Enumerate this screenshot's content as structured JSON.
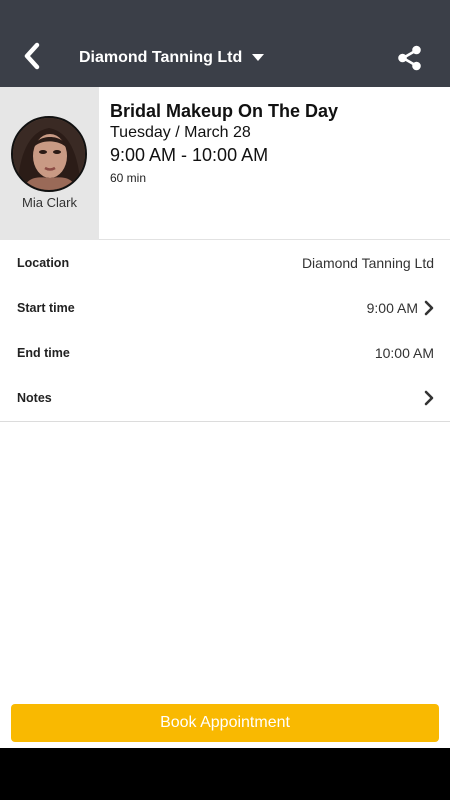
{
  "header": {
    "title": "Diamond Tanning Ltd",
    "back_icon": "chevron-left-icon",
    "dropdown_icon": "caret-down-icon",
    "share_icon": "share-icon",
    "background": "#3b3f48"
  },
  "staff": {
    "name": "Mia Clark"
  },
  "appointment": {
    "title": "Bridal Makeup On The Day",
    "date": "Tuesday / March 28",
    "time": "9:00 AM - 10:00 AM",
    "duration": "60 min"
  },
  "details": {
    "location": {
      "label": "Location",
      "value": "Diamond Tanning Ltd"
    },
    "start_time": {
      "label": "Start time",
      "value": "9:00 AM"
    },
    "end_time": {
      "label": "End time",
      "value": "10:00 AM"
    },
    "notes": {
      "label": "Notes"
    }
  },
  "book_button": {
    "label": "Book Appointment",
    "color": "#f9b901"
  }
}
